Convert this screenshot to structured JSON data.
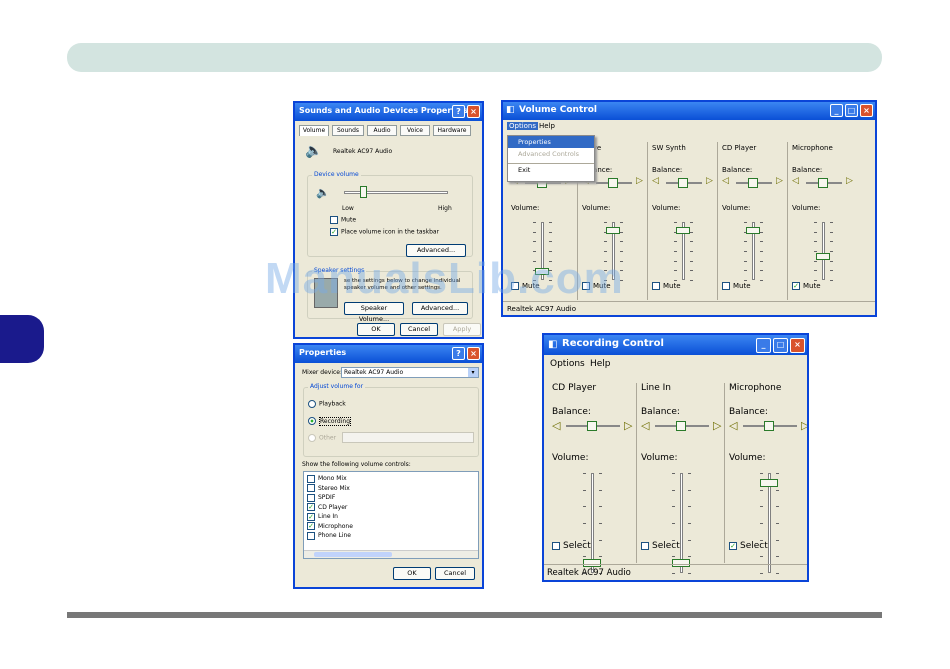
{
  "page": {
    "watermark": "ManualsLib.com"
  },
  "sounds": {
    "title": "Sounds and Audio Devices Properties",
    "tabs": [
      "Volume",
      "Sounds",
      "Audio",
      "Voice",
      "Hardware"
    ],
    "device": "Realtek AC97 Audio",
    "device_volume_group": "Device volume",
    "low": "Low",
    "high": "High",
    "mute": "Mute",
    "place_icon": "Place volume icon in the taskbar",
    "advanced": "Advanced...",
    "speaker_group": "Speaker settings",
    "speaker_text": "se the settings below to change individual speaker volume and other settings.",
    "speaker_volume": "Speaker Volume...",
    "advanced2": "Advanced...",
    "ok": "OK",
    "cancel": "Cancel",
    "apply": "Apply"
  },
  "properties": {
    "title": "Properties",
    "mixer_label": "Mixer device:",
    "mixer_value": "Realtek AC97 Audio",
    "adjust_label": "Adjust volume for",
    "playback": "Playback",
    "recording": "Recording",
    "other": "Other",
    "show_label": "Show the following volume controls:",
    "controls": [
      {
        "label": "Mono Mix",
        "checked": false
      },
      {
        "label": "Stereo Mix",
        "checked": false
      },
      {
        "label": "SPDIF",
        "checked": false
      },
      {
        "label": "CD Player",
        "checked": true
      },
      {
        "label": "Line In",
        "checked": true
      },
      {
        "label": "Microphone",
        "checked": true
      },
      {
        "label": "Phone Line",
        "checked": false
      }
    ],
    "ok": "OK",
    "cancel": "Cancel"
  },
  "volume_control": {
    "title": "Volume Control",
    "menu": [
      "Options",
      "Help"
    ],
    "options_menu": [
      {
        "label": "Properties",
        "state": "highlighted"
      },
      {
        "label": "Advanced Controls",
        "state": "disabled"
      },
      {
        "label": "Exit",
        "state": "normal"
      }
    ],
    "columns": [
      {
        "name": "",
        "balance": "Balance:",
        "volume": "Volume:",
        "mute": "Mute",
        "checked": false,
        "level": 0.15
      },
      {
        "name": "Wave",
        "balance": "Balance:",
        "volume": "Volume:",
        "mute": "Mute",
        "checked": false,
        "level": 0.85
      },
      {
        "name": "SW Synth",
        "balance": "Balance:",
        "volume": "Volume:",
        "mute": "Mute",
        "checked": false,
        "level": 0.85
      },
      {
        "name": "CD Player",
        "balance": "Balance:",
        "volume": "Volume:",
        "mute": "Mute",
        "checked": false,
        "level": 0.85
      },
      {
        "name": "Microphone",
        "balance": "Balance:",
        "volume": "Volume:",
        "mute": "Mute",
        "checked": true,
        "level": 0.4
      }
    ],
    "status": "Realtek AC97 Audio"
  },
  "recording_control": {
    "title": "Recording Control",
    "menu": [
      "Options",
      "Help"
    ],
    "columns": [
      {
        "name": "CD Player",
        "balance": "Balance:",
        "volume": "Volume:",
        "select": "Select",
        "checked": false,
        "level": 0.1
      },
      {
        "name": "Line In",
        "balance": "Balance:",
        "volume": "Volume:",
        "select": "Select",
        "checked": false,
        "level": 0.1
      },
      {
        "name": "Microphone",
        "balance": "Balance:",
        "volume": "Volume:",
        "select": "Select",
        "checked": true,
        "level": 0.9
      }
    ],
    "status": "Realtek AC97 Audio"
  }
}
